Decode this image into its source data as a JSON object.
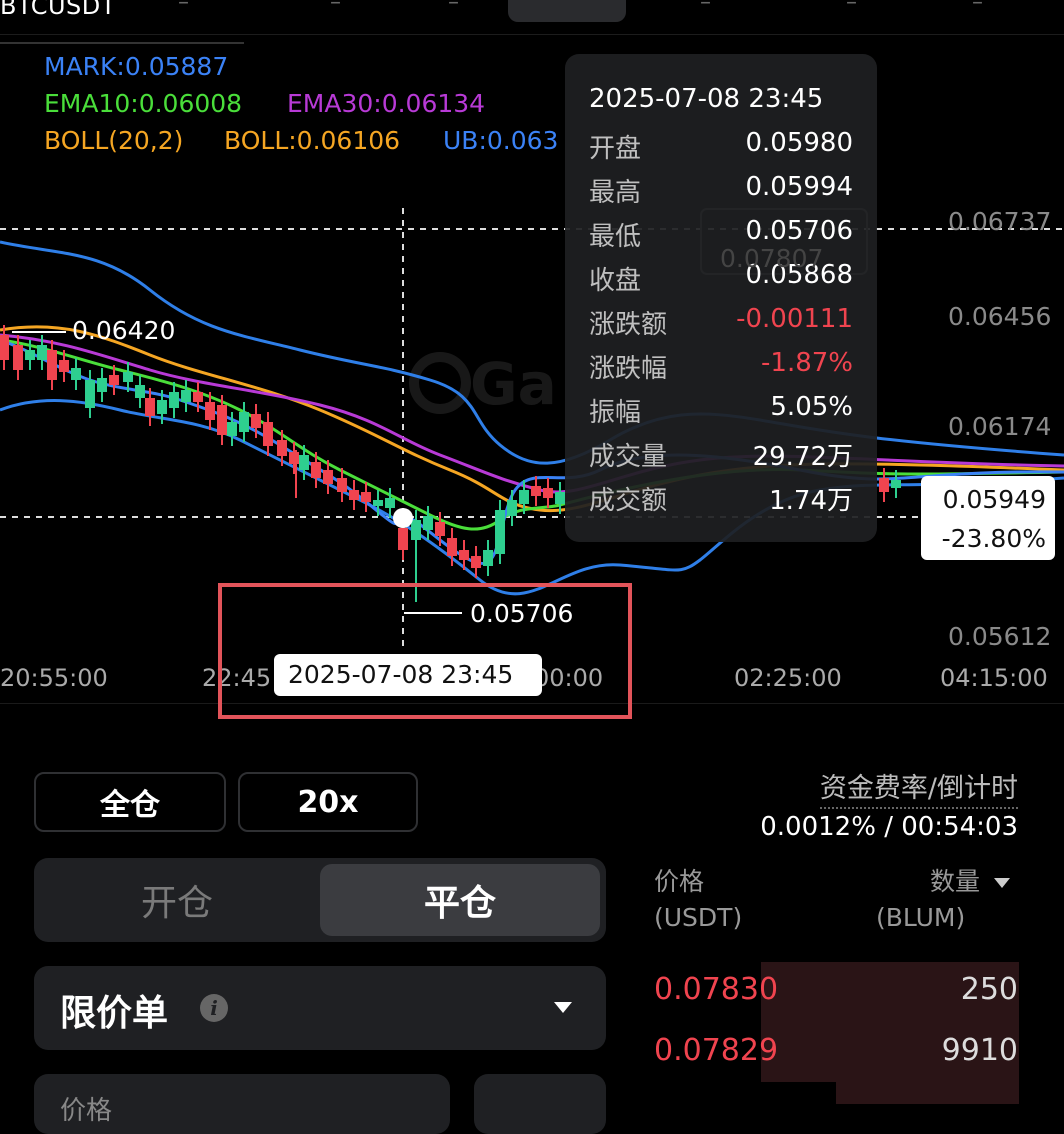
{
  "header": {
    "symbol": "BTCUSDT"
  },
  "indicators": {
    "mark": "MARK:0.05887",
    "ema10": "EMA10:0.06008",
    "ema30": "EMA30:0.06134",
    "boll": "BOLL(20,2)",
    "boll_mid": "BOLL:0.06106",
    "boll_ub": "UB:0.063",
    "colors": {
      "mark": "#3b82f6",
      "ema10": "#4ade3a",
      "ema30": "#b83ad6",
      "boll": "#f5a623",
      "ub": "#3b82f6"
    }
  },
  "chart": {
    "price_axis": [
      "0.06737",
      "0.06456",
      "0.06174",
      "0.05612"
    ],
    "time_axis": [
      "20:55:00",
      "22:45",
      "00:00",
      "02:25:00",
      "04:15:00"
    ],
    "high_marker": "0.06420",
    "low_marker": "0.05706",
    "current_price": "0.05949",
    "current_change": "-23.80%",
    "crosshair_time": "2025-07-08 23:45",
    "hidden_box_value": "0.07807",
    "colors": {
      "up": "#2ecf8f",
      "down": "#f0444f",
      "highlight": "#e2545a"
    }
  },
  "tooltip": {
    "datetime": "2025-07-08 23:45",
    "rows": [
      {
        "label": "开盘",
        "value": "0.05980"
      },
      {
        "label": "最高",
        "value": "0.05994"
      },
      {
        "label": "最低",
        "value": "0.05706"
      },
      {
        "label": "收盘",
        "value": "0.05868"
      },
      {
        "label": "涨跌额",
        "value": "-0.00111"
      },
      {
        "label": "涨跌幅",
        "value": "-1.87%"
      },
      {
        "label": "振幅",
        "value": "5.05%"
      },
      {
        "label": "成交量",
        "value": "29.72万"
      },
      {
        "label": "成交额",
        "value": "1.74万"
      }
    ]
  },
  "trade": {
    "margin_mode": "全仓",
    "leverage": "20x",
    "funding_label": "资金费率/倒计时",
    "funding_value": "0.0012% / 00:54:03",
    "tab_open": "开仓",
    "tab_close": "平仓",
    "order_type": "限价单",
    "info_icon": "i",
    "price_label": "价格"
  },
  "orderbook": {
    "price_header": "价格",
    "price_unit": "(USDT)",
    "qty_header": "数量",
    "qty_unit": "(BLUM)",
    "asks": [
      {
        "price": "0.07830",
        "qty": "250"
      },
      {
        "price": "0.07829",
        "qty": "9910"
      }
    ]
  }
}
